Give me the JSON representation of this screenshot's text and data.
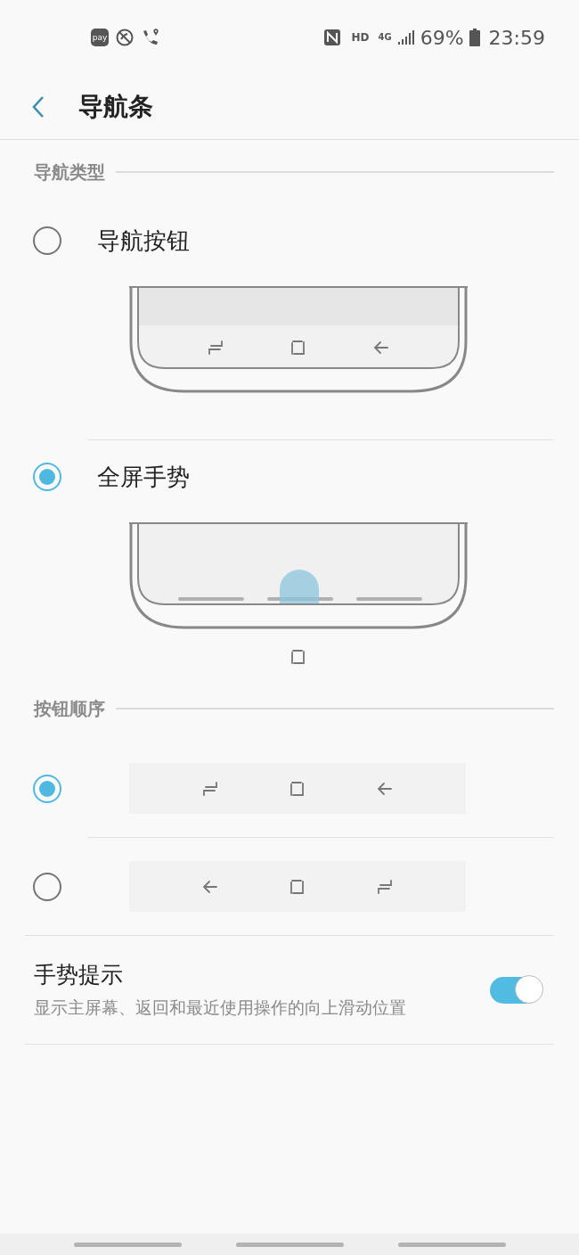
{
  "status_bar": {
    "pay": "pay",
    "hd": "HD",
    "network": "4G",
    "battery": "69%",
    "time": "23:59"
  },
  "header": {
    "title": "导航条"
  },
  "navigation_type": {
    "title": "导航类型",
    "options": [
      {
        "label": "导航按钮",
        "selected": false,
        "kind": "buttons"
      },
      {
        "label": "全屏手势",
        "selected": true,
        "kind": "gestures"
      }
    ]
  },
  "button_order": {
    "title": "按钮顺序",
    "options": [
      {
        "selected": true,
        "buttons": [
          {
            "kind": "recent"
          },
          {
            "kind": "home"
          },
          {
            "kind": "back"
          }
        ]
      },
      {
        "selected": false,
        "buttons": [
          {
            "kind": "back"
          },
          {
            "kind": "home"
          },
          {
            "kind": "recent"
          }
        ]
      }
    ]
  },
  "gesture_hints": {
    "title": "手势提示",
    "description": "显示主屏幕、返回和最近使用操作的向上滑动位置",
    "on": true
  }
}
